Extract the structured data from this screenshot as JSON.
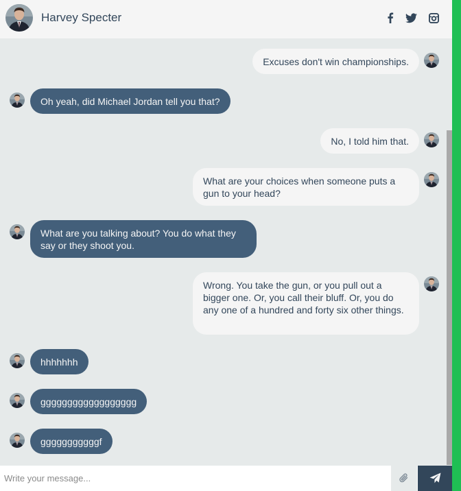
{
  "contact": {
    "name": "Harvey Specter",
    "social_icons": [
      "facebook-icon",
      "twitter-icon",
      "instagram-icon"
    ]
  },
  "messages": [
    {
      "side": "replies",
      "text": "Excuses don't win championships."
    },
    {
      "side": "sent",
      "text": "Oh yeah, did Michael Jordan tell you that?"
    },
    {
      "side": "replies",
      "text": "No, I told him that."
    },
    {
      "side": "replies",
      "text": "What are your choices when someone puts a gun to your head?"
    },
    {
      "side": "sent",
      "text": "What are you talking about? You do what they say or they shoot you."
    },
    {
      "side": "replies",
      "text": "Wrong. You take the gun, or you pull out a bigger one. Or, you call their bluff. Or, you do any one of a hundred and forty six other things."
    },
    {
      "side": "sent",
      "text": "hhhhhhh"
    },
    {
      "side": "sent",
      "text": "gggggggggggggggggg"
    },
    {
      "side": "sent",
      "text": "gggggggggggf"
    }
  ],
  "compose": {
    "placeholder": "Write your message..."
  },
  "colors": {
    "sent_bubble": "#435f7a",
    "reply_bubble": "#f5f5f5",
    "background": "#e6eaea",
    "send_button": "#32465a",
    "accent_strip": "#1fbf54"
  }
}
